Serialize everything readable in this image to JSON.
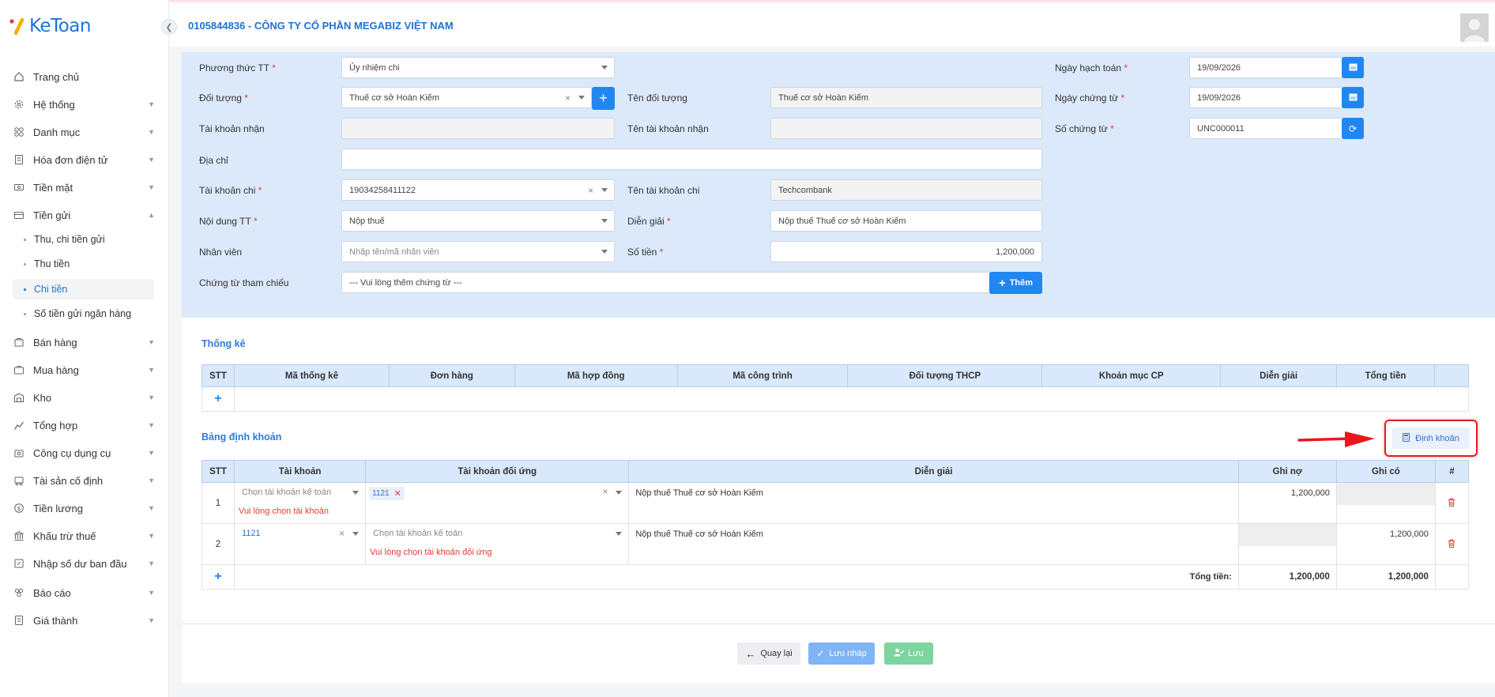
{
  "app": {
    "logo_text": "KeToan",
    "company": "0105844836 - CÔNG TY CỔ PHẦN MEGABIZ VIỆT NAM"
  },
  "sidebar": {
    "items": [
      {
        "label": "Trang chủ",
        "icon": "home-icon"
      },
      {
        "label": "Hệ thống",
        "icon": "gear-icon"
      },
      {
        "label": "Danh mục",
        "icon": "grid-icon"
      },
      {
        "label": "Hóa đơn điện tử",
        "icon": "invoice-icon"
      },
      {
        "label": "Tiền mặt",
        "icon": "cash-icon"
      },
      {
        "label": "Tiền gửi",
        "icon": "bank-deposit-icon"
      },
      {
        "label": "Bán hàng",
        "icon": "sale-icon"
      },
      {
        "label": "Mua hàng",
        "icon": "purchase-icon"
      },
      {
        "label": "Kho",
        "icon": "warehouse-icon"
      },
      {
        "label": "Tổng hợp",
        "icon": "chart-icon"
      },
      {
        "label": "Công cụ dụng cụ",
        "icon": "tools-icon"
      },
      {
        "label": "Tài sản cố định",
        "icon": "asset-icon"
      },
      {
        "label": "Tiền lương",
        "icon": "salary-icon"
      },
      {
        "label": "Khấu trừ thuế",
        "icon": "tax-icon"
      },
      {
        "label": "Nhập số dư ban đầu",
        "icon": "opening-balance-icon"
      },
      {
        "label": "Báo cáo",
        "icon": "report-icon"
      },
      {
        "label": "Giá thành",
        "icon": "cost-icon"
      }
    ],
    "sub_items": [
      "Thu, chi tiền gửi",
      "Thu tiền",
      "Chi tiền",
      "Số tiền gửi ngân hàng"
    ]
  },
  "form": {
    "phuong_thuc": {
      "label": "Phương thức TT",
      "value": "Ủy nhiệm chi"
    },
    "doi_tuong": {
      "label": "Đối tượng",
      "value": "Thuế cơ sở Hoàn Kiếm"
    },
    "ten_doi_tuong": {
      "label": "Tên đối tượng",
      "value": "Thuế cơ sở Hoàn Kiếm"
    },
    "tk_nhan": {
      "label": "Tài khoản nhận",
      "value": ""
    },
    "ten_tk_nhan": {
      "label": "Tên tài khoản nhận",
      "value": ""
    },
    "dia_chi": {
      "label": "Địa chỉ",
      "value": ""
    },
    "tk_chi": {
      "label": "Tài khoản chi",
      "value": "19034258411122"
    },
    "ten_tk_chi": {
      "label": "Tên tài khoản chi",
      "value": "Techcombank"
    },
    "noi_dung": {
      "label": "Nội dung TT",
      "value": "Nộp thuế"
    },
    "dien_giai": {
      "label": "Diễn giải",
      "value": "Nộp thuế Thuế cơ sở Hoàn Kiếm"
    },
    "nhan_vien": {
      "label": "Nhân viên",
      "placeholder": "Nhập tên/mã nhân viên"
    },
    "so_tien": {
      "label": "Số tiền",
      "value": "1,200,000"
    },
    "chung_tu": {
      "label": "Chứng từ tham chiếu",
      "placeholder": "--- Vui lòng thêm chứng từ ---",
      "button": "Thêm"
    },
    "ngay_hach_toan": {
      "label": "Ngày hạch toán",
      "value": "19/09/2026"
    },
    "ngay_chung_tu": {
      "label": "Ngày chứng từ",
      "value": "19/09/2026"
    },
    "so_chung_tu": {
      "label": "Số chứng từ",
      "value": "UNC000011"
    },
    "required_mark": "*"
  },
  "thong_ke": {
    "title": "Thống kê",
    "columns": [
      "STT",
      "Mã thống kê",
      "Đơn hàng",
      "Mã hợp đồng",
      "Mã công trình",
      "Đối tượng THCP",
      "Khoản mục CP",
      "Diễn giải",
      "Tổng tiền",
      ""
    ]
  },
  "dinh_khoan": {
    "title": "Bảng định khoản",
    "button": "Định khoản",
    "columns": [
      "STT",
      "Tài khoản",
      "Tài khoản đối ứng",
      "Diễn giải",
      "Ghi nợ",
      "Ghi có",
      "#"
    ],
    "account_placeholder": "Chọn tài khoản kế toán",
    "rows": [
      {
        "stt": "1",
        "tai_khoan": "",
        "doi_ung_tag": "1121",
        "error": "Vui lòng chọn tài khoản",
        "dien_giai": "Nộp thuế Thuế cơ sở Hoàn Kiếm",
        "ghi_no": "1,200,000",
        "ghi_co": ""
      },
      {
        "stt": "2",
        "tai_khoan": "1121",
        "doi_ung_tag": "",
        "error": "Vui lòng chọn tài khoản đối ứng",
        "dien_giai": "Nộp thuế Thuế cơ sở Hoàn Kiếm",
        "ghi_no": "",
        "ghi_co": "1,200,000"
      }
    ],
    "total_label": "Tổng tiền:",
    "total_no": "1,200,000",
    "total_co": "1,200,000"
  },
  "actions": {
    "back": "Quay lại",
    "draft": "Lưu nháp",
    "save": "Lưu"
  },
  "colors": {
    "primary": "#2286f0",
    "form_bg": "#dbe9fb",
    "error": "#e53935",
    "highlight": "#e53935"
  }
}
